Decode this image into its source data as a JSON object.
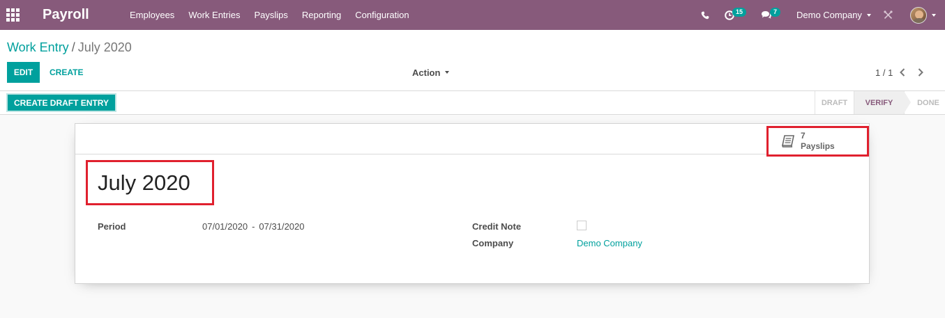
{
  "navbar": {
    "app_name": "Payroll",
    "menu": [
      "Employees",
      "Work Entries",
      "Payslips",
      "Reporting",
      "Configuration"
    ],
    "activity_count": "15",
    "message_count": "7",
    "company": "Demo Company",
    "color": "#875a7b"
  },
  "breadcrumb": {
    "parent": "Work Entry",
    "separator": "/",
    "current": "July 2020"
  },
  "toolbar": {
    "edit_label": "EDIT",
    "create_label": "CREATE",
    "action_label": "Action",
    "pager": "1 / 1"
  },
  "statusbar": {
    "draft_button_label": "CREATE DRAFT ENTRY",
    "stages": [
      "DRAFT",
      "VERIFY",
      "DONE"
    ],
    "active_stage": "VERIFY"
  },
  "smart_button": {
    "value": "7",
    "label": "Payslips",
    "icon": "book-icon"
  },
  "form": {
    "title": "July 2020",
    "period_label": "Period",
    "period_start": "07/01/2020",
    "period_separator": "-",
    "period_end": "07/31/2020",
    "credit_note_label": "Credit Note",
    "credit_note_checked": false,
    "company_label": "Company",
    "company_value": "Demo Company"
  },
  "colors": {
    "accent": "#00a09d",
    "highlight": "#e0202e"
  }
}
